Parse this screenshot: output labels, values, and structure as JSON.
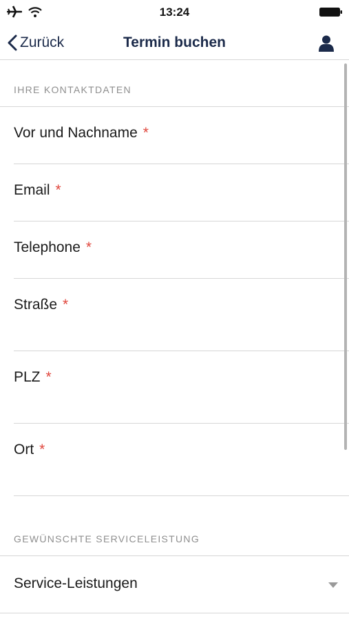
{
  "status_bar": {
    "time": "13:24",
    "icons": [
      "airplane-icon",
      "wifi-icon",
      "battery-icon"
    ]
  },
  "nav": {
    "back_label": "Zurück",
    "title": "Termin buchen",
    "user_icon": "user-icon"
  },
  "sections": {
    "contact": "IHRE KONTAKTDATEN",
    "service": "GEWÜNSCHTE SERVICELEISTUNG"
  },
  "fields": [
    {
      "label": "Vor und Nachname",
      "required": "*"
    },
    {
      "label": "Email",
      "required": "*"
    },
    {
      "label": "Telephone",
      "required": "*"
    },
    {
      "label": "Straße",
      "required": "*"
    },
    {
      "label": "PLZ",
      "required": "*"
    },
    {
      "label": "Ort",
      "required": "*"
    }
  ],
  "service_select": {
    "label": "Service-Leistungen",
    "icon": "chevron-down-icon"
  },
  "colors": {
    "text": "#1a1a1a",
    "nav_text": "#1b2a4a",
    "required": "#e0463c",
    "section_label": "#8e8e8e",
    "divider": "#d6d6d6"
  }
}
